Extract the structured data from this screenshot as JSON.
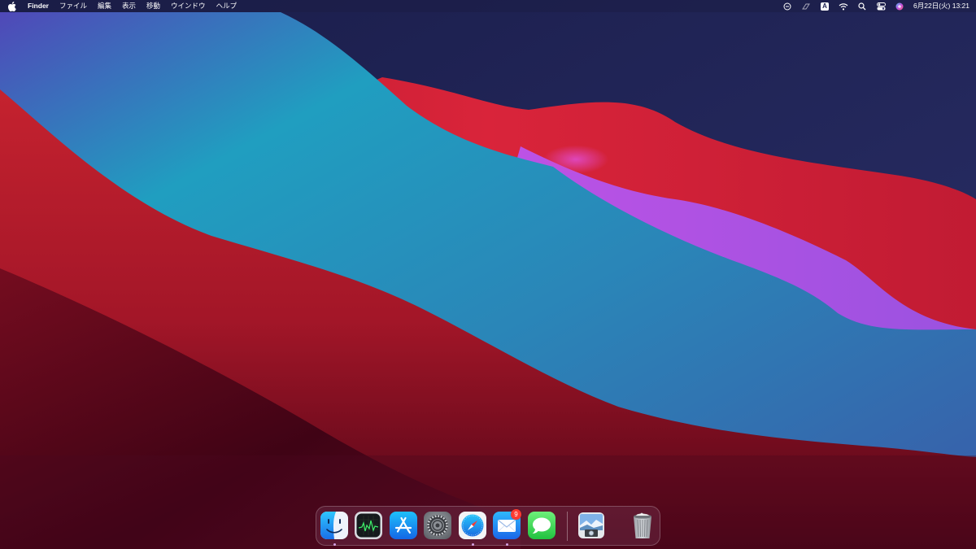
{
  "menubar": {
    "app_name": "Finder",
    "menus": [
      "ファイル",
      "編集",
      "表示",
      "移動",
      "ウインドウ",
      "ヘルプ"
    ],
    "status_icons": [
      "focus-icon",
      "stylus-icon",
      "input-source-icon",
      "wifi-icon",
      "spotlight-icon",
      "control-center-icon",
      "siri-icon"
    ],
    "input_source": "A",
    "clock": "6月22日(火)  13:21"
  },
  "dock": {
    "apps": [
      {
        "name": "Finder",
        "icon": "finder-icon",
        "running": true
      },
      {
        "name": "Activity Monitor",
        "icon": "activity-monitor-icon",
        "running": false
      },
      {
        "name": "App Store",
        "icon": "app-store-icon",
        "running": false
      },
      {
        "name": "System Preferences",
        "icon": "system-preferences-icon",
        "running": false
      },
      {
        "name": "Safari",
        "icon": "safari-icon",
        "running": true
      },
      {
        "name": "Mail",
        "icon": "mail-icon",
        "running": true,
        "badge": "9"
      },
      {
        "name": "Messages",
        "icon": "messages-icon",
        "running": false
      },
      {
        "name": "Preview",
        "icon": "preview-icon",
        "running": false
      },
      {
        "name": "Trash",
        "icon": "trash-icon",
        "running": false
      }
    ]
  },
  "colors": {
    "wallpaper_red": "#c8202e",
    "wallpaper_teal": "#1e9fbf",
    "wallpaper_purple": "#a04ee0",
    "wallpaper_navy": "#1c2050",
    "badge_red": "#ff3b30"
  }
}
